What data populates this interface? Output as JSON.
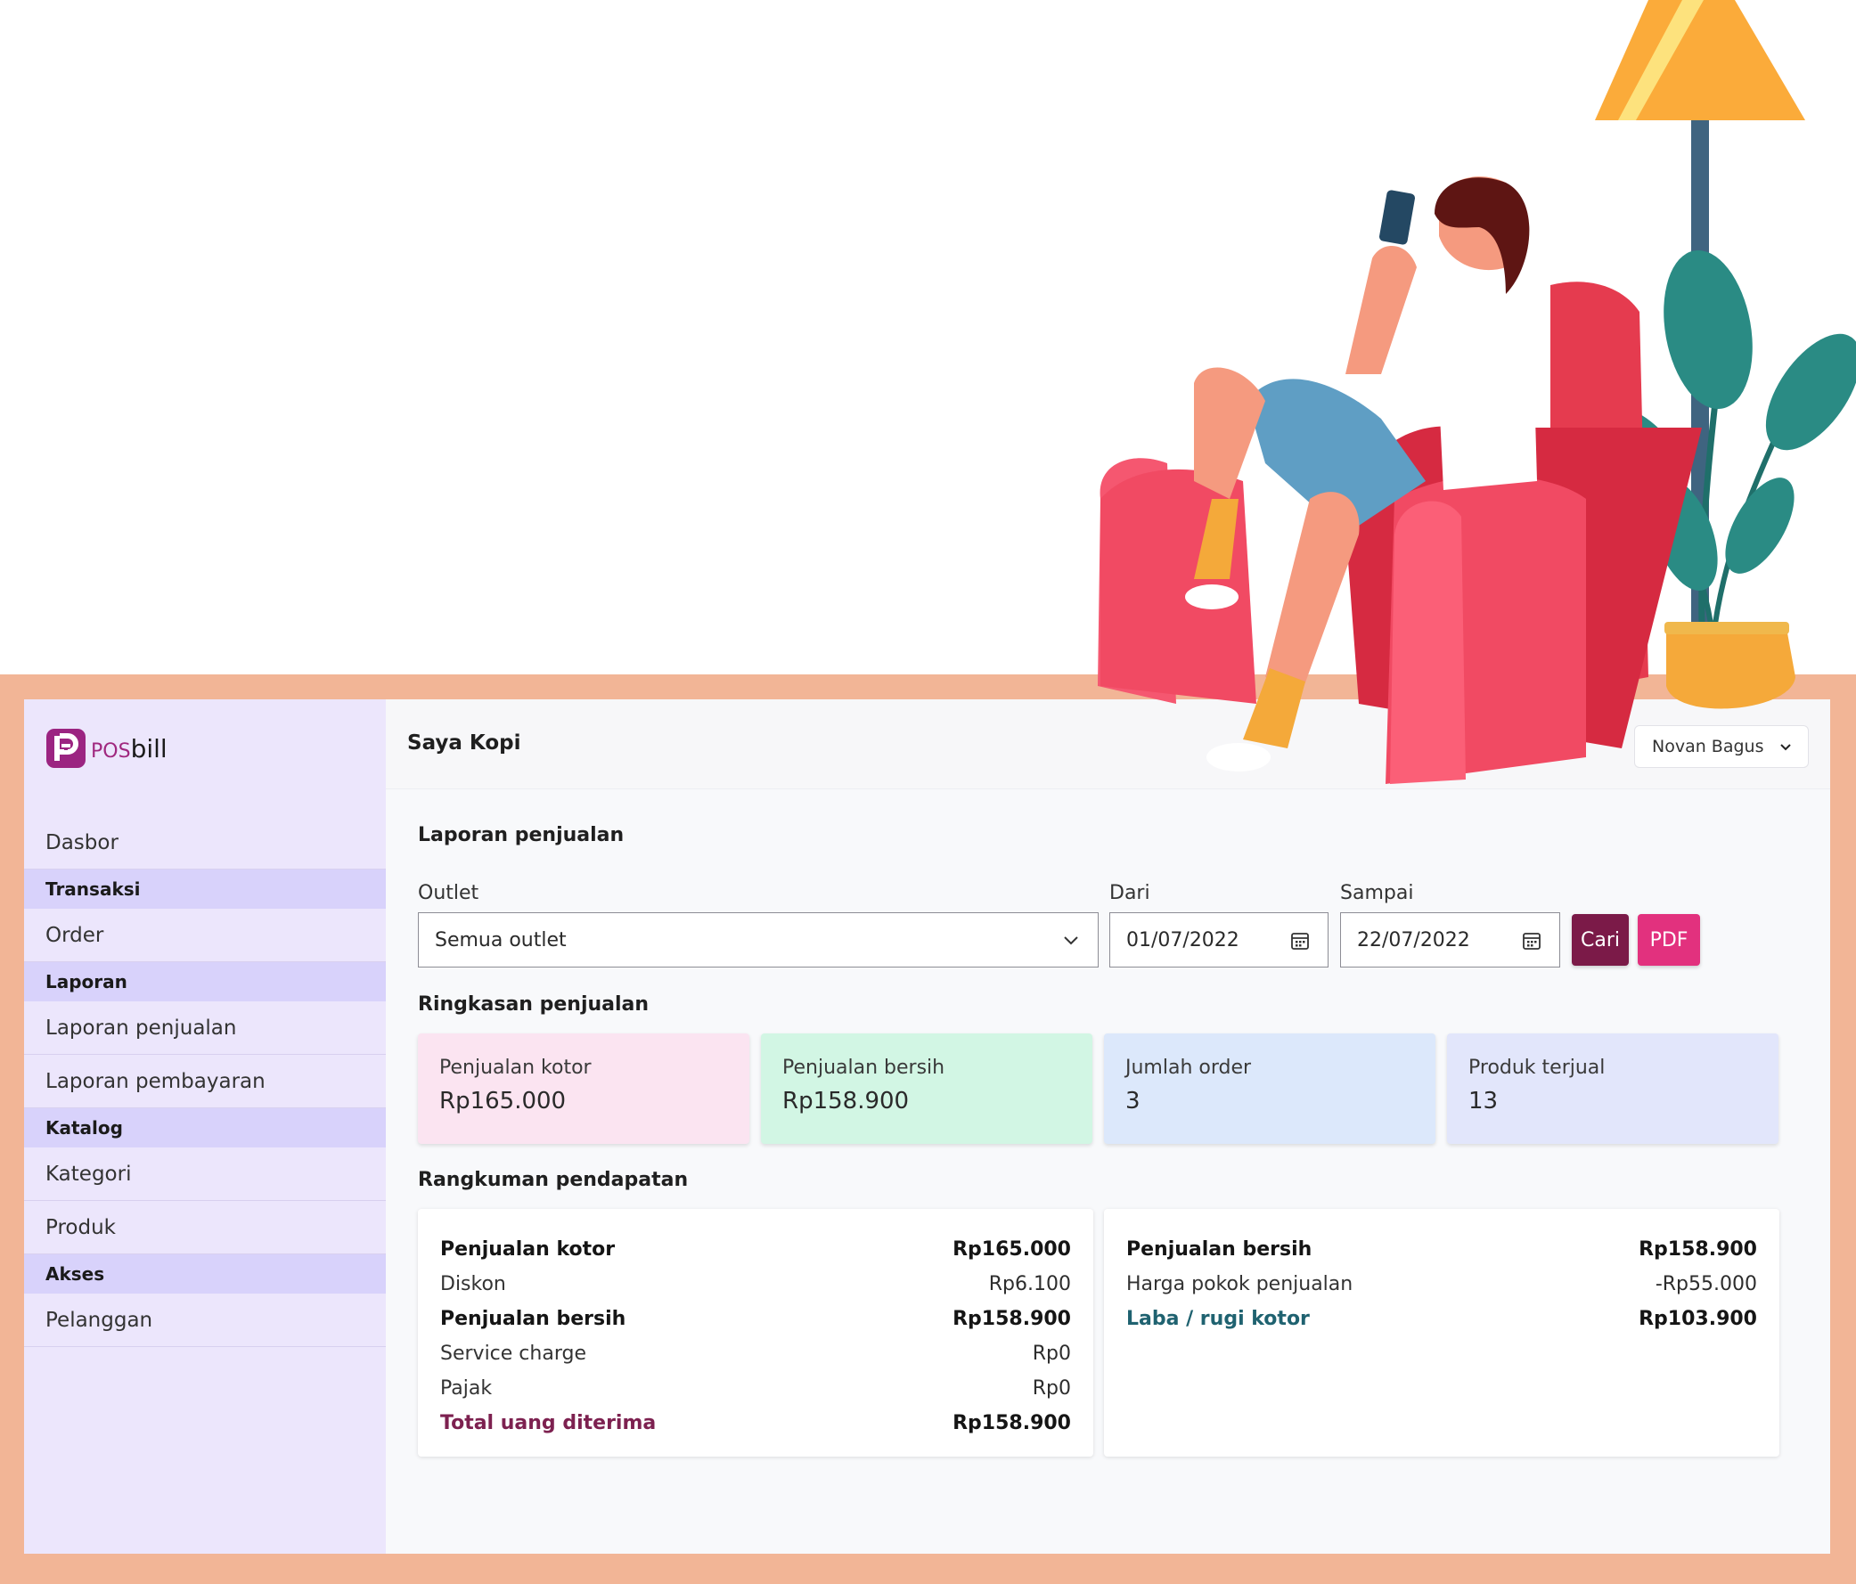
{
  "brand": {
    "name_prefix": "POS",
    "name_suffix": "bill"
  },
  "sidebar": {
    "items": [
      {
        "type": "item",
        "label": "Dasbor"
      },
      {
        "type": "section",
        "label": "Transaksi"
      },
      {
        "type": "item",
        "label": "Order"
      },
      {
        "type": "section",
        "label": "Laporan"
      },
      {
        "type": "item",
        "label": "Laporan penjualan"
      },
      {
        "type": "item",
        "label": "Laporan pembayaran"
      },
      {
        "type": "section",
        "label": "Katalog"
      },
      {
        "type": "item",
        "label": "Kategori"
      },
      {
        "type": "item",
        "label": "Produk"
      },
      {
        "type": "section",
        "label": "Akses"
      },
      {
        "type": "item",
        "label": "Pelanggan"
      }
    ]
  },
  "header": {
    "store": "Saya Kopi",
    "user": "Novan Bagus"
  },
  "page": {
    "title": "Laporan penjualan"
  },
  "filters": {
    "outlet_label": "Outlet",
    "outlet_value": "Semua outlet",
    "from_label": "Dari",
    "from_value": "01/07/2022",
    "to_label": "Sampai",
    "to_value": "22/07/2022",
    "search_button": "Cari",
    "pdf_button": "PDF"
  },
  "summary": {
    "title": "Ringkasan penjualan",
    "cards": [
      {
        "label": "Penjualan kotor",
        "value": "Rp165.000",
        "color": "#fbe4f1"
      },
      {
        "label": "Penjualan bersih",
        "value": "Rp158.900",
        "color": "#d2f6e4"
      },
      {
        "label": "Jumlah order",
        "value": "3",
        "color": "#dce8fb"
      },
      {
        "label": "Produk terjual",
        "value": "13",
        "color": "#e2e6fb"
      }
    ]
  },
  "income": {
    "title": "Rangkuman pendapatan",
    "left": [
      {
        "label": "Penjualan kotor",
        "value": "Rp165.000",
        "style": "bold"
      },
      {
        "label": "Diskon",
        "value": "Rp6.100",
        "style": "normal"
      },
      {
        "label": "Penjualan bersih",
        "value": "Rp158.900",
        "style": "bold"
      },
      {
        "label": "Service charge",
        "value": "Rp0",
        "style": "normal"
      },
      {
        "label": "Pajak",
        "value": "Rp0",
        "style": "normal"
      },
      {
        "label": "Total uang diterima",
        "value": "Rp158.900",
        "style": "total"
      }
    ],
    "right": [
      {
        "label": "Penjualan bersih",
        "value": "Rp158.900",
        "style": "bold"
      },
      {
        "label": "Harga pokok penjualan",
        "value": "-Rp55.000",
        "style": "normal"
      },
      {
        "label": "Laba / rugi kotor",
        "value": "Rp103.900",
        "style": "profit"
      }
    ]
  },
  "colors": {
    "brand": "#9b2481",
    "cari": "#7b1a48",
    "pdf": "#e2317e",
    "frame": "#f2b596",
    "sidebar": "#ece6fc"
  }
}
